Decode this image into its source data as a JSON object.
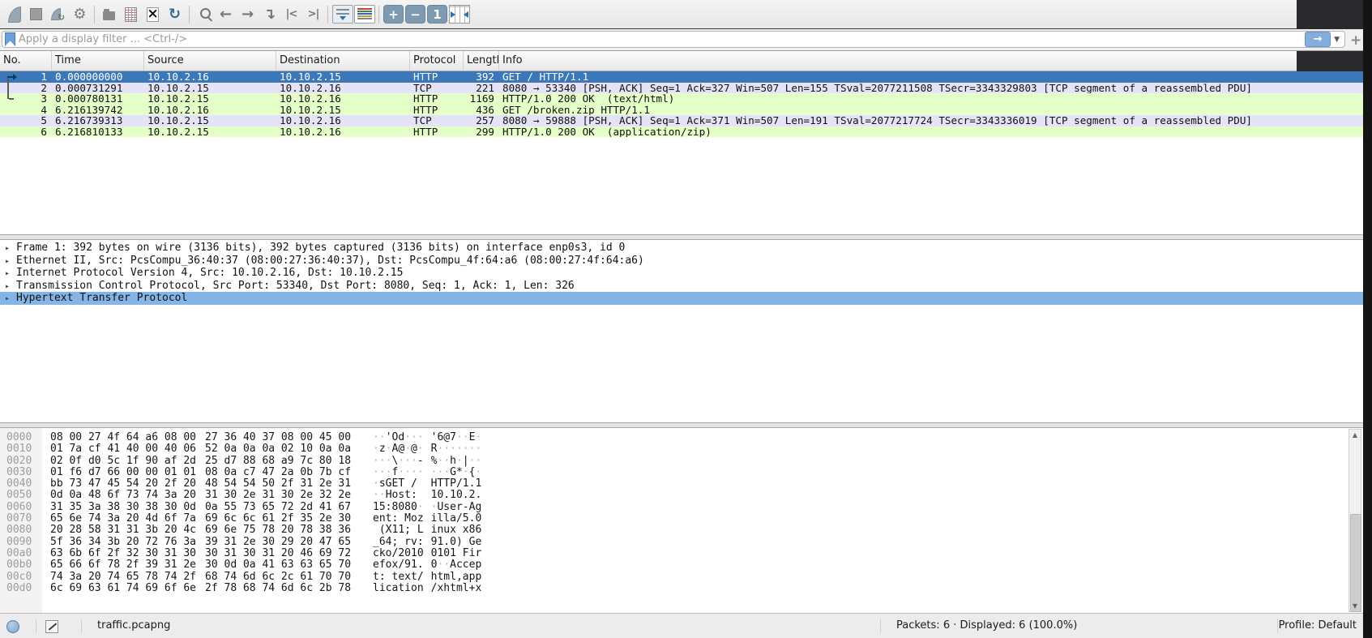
{
  "colors": {
    "selected_row": "#3c78b8",
    "tcp_row": "#e4e3f7",
    "http_row": "#e4ffc7",
    "details_selected": "#85b5e6",
    "apply_button": "#85acdd"
  },
  "toolbar": {
    "icons": [
      {
        "name": "start-capture-icon",
        "kind": "fin"
      },
      {
        "name": "stop-capture-icon",
        "kind": "stop"
      },
      {
        "name": "restart-capture-icon",
        "kind": "fin-restart",
        "glyph": "↻"
      },
      {
        "name": "capture-options-icon",
        "kind": "glyph",
        "glyph": "⚙"
      },
      {
        "kind": "separator"
      },
      {
        "name": "open-file-icon",
        "kind": "folder"
      },
      {
        "name": "save-file-icon",
        "kind": "savedoc"
      },
      {
        "name": "close-file-icon",
        "kind": "closedoc",
        "glyph": "×"
      },
      {
        "name": "reload-file-icon",
        "kind": "glyph-reload",
        "glyph": "↻"
      },
      {
        "kind": "separator"
      },
      {
        "name": "find-packet-icon",
        "kind": "magnifier"
      },
      {
        "name": "go-back-icon",
        "kind": "glyph",
        "glyph": "←"
      },
      {
        "name": "go-forward-icon",
        "kind": "glyph",
        "glyph": "→"
      },
      {
        "name": "go-to-packet-icon",
        "kind": "glyph",
        "glyph": "↴"
      },
      {
        "name": "go-first-packet-icon",
        "kind": "glyph-small",
        "glyph": "|<"
      },
      {
        "name": "go-last-packet-icon",
        "kind": "glyph-small",
        "glyph": ">|"
      },
      {
        "kind": "separator"
      },
      {
        "name": "auto-scroll-icon",
        "kind": "autoscroll"
      },
      {
        "name": "colorize-icon",
        "kind": "colorize"
      },
      {
        "kind": "separator"
      },
      {
        "name": "zoom-in-icon",
        "kind": "bluebtn",
        "glyph": "+"
      },
      {
        "name": "zoom-out-icon",
        "kind": "bluebtn",
        "glyph": "−"
      },
      {
        "name": "zoom-100-icon",
        "kind": "bluebtn",
        "glyph": "1"
      },
      {
        "name": "resize-columns-icon",
        "kind": "resizecols"
      }
    ]
  },
  "filter_bar": {
    "placeholder": "Apply a display filter ... <Ctrl-/>",
    "apply_arrow": "→",
    "dropdown_caret": "▼",
    "add_button": "+"
  },
  "packet_list": {
    "columns": [
      "No.",
      "Time",
      "Source",
      "Destination",
      "Protocol",
      "Length",
      "Info"
    ],
    "rows": [
      {
        "no": "1",
        "time": "0.000000000",
        "source": "10.10.2.16",
        "destination": "10.10.2.15",
        "protocol": "HTTP",
        "length": "392",
        "info": "GET / HTTP/1.1",
        "state": "selected"
      },
      {
        "no": "2",
        "time": "0.000731291",
        "source": "10.10.2.15",
        "destination": "10.10.2.16",
        "protocol": "TCP",
        "length": "221",
        "info": "8080 → 53340 [PSH, ACK] Seq=1 Ack=327 Win=507 Len=155 TSval=2077211508 TSecr=3343329803 [TCP segment of a reassembled PDU]",
        "state": "tcp"
      },
      {
        "no": "3",
        "time": "0.000780131",
        "source": "10.10.2.15",
        "destination": "10.10.2.16",
        "protocol": "HTTP",
        "length": "1169",
        "info": "HTTP/1.0 200 OK  (text/html)",
        "state": "http"
      },
      {
        "no": "4",
        "time": "6.216139742",
        "source": "10.10.2.16",
        "destination": "10.10.2.15",
        "protocol": "HTTP",
        "length": "436",
        "info": "GET /broken.zip HTTP/1.1",
        "state": "http"
      },
      {
        "no": "5",
        "time": "6.216739313",
        "source": "10.10.2.15",
        "destination": "10.10.2.16",
        "protocol": "TCP",
        "length": "257",
        "info": "8080 → 59888 [PSH, ACK] Seq=1 Ack=371 Win=507 Len=191 TSval=2077217724 TSecr=3343336019 [TCP segment of a reassembled PDU]",
        "state": "tcp"
      },
      {
        "no": "6",
        "time": "6.216810133",
        "source": "10.10.2.15",
        "destination": "10.10.2.16",
        "protocol": "HTTP",
        "length": "299",
        "info": "HTTP/1.0 200 OK  (application/zip)",
        "state": "http"
      }
    ]
  },
  "details": {
    "expander": "▸",
    "rows": [
      {
        "text": "Frame 1: 392 bytes on wire (3136 bits), 392 bytes captured (3136 bits) on interface enp0s3, id 0",
        "selected": false
      },
      {
        "text": "Ethernet II, Src: PcsCompu_36:40:37 (08:00:27:36:40:37), Dst: PcsCompu_4f:64:a6 (08:00:27:4f:64:a6)",
        "selected": false
      },
      {
        "text": "Internet Protocol Version 4, Src: 10.10.2.16, Dst: 10.10.2.15",
        "selected": false
      },
      {
        "text": "Transmission Control Protocol, Src Port: 53340, Dst Port: 8080, Seq: 1, Ack: 1, Len: 326",
        "selected": false
      },
      {
        "text": "Hypertext Transfer Protocol",
        "selected": true
      }
    ]
  },
  "hex_dump": {
    "rows": [
      {
        "offset": "0000",
        "hex1": "08 00 27 4f 64 a6 08 00",
        "hex2": "27 36 40 37 08 00 45 00",
        "ascii1": "··'Od···",
        "ascii2": "'6@7··E·"
      },
      {
        "offset": "0010",
        "hex1": "01 7a cf 41 40 00 40 06",
        "hex2": "52 0a 0a 0a 02 10 0a 0a",
        "ascii1": "·z·A@·@·",
        "ascii2": "R·······"
      },
      {
        "offset": "0020",
        "hex1": "02 0f d0 5c 1f 90 af 2d",
        "hex2": "25 d7 88 68 a9 7c 80 18",
        "ascii1": "···\\···-",
        "ascii2": "%··h·|··"
      },
      {
        "offset": "0030",
        "hex1": "01 f6 d7 66 00 00 01 01",
        "hex2": "08 0a c7 47 2a 0b 7b cf",
        "ascii1": "···f····",
        "ascii2": "···G*·{·"
      },
      {
        "offset": "0040",
        "hex1": "bb 73 47 45 54 20 2f 20",
        "hex2": "48 54 54 50 2f 31 2e 31",
        "ascii1": "·sGET / ",
        "ascii2": "HTTP/1.1"
      },
      {
        "offset": "0050",
        "hex1": "0d 0a 48 6f 73 74 3a 20",
        "hex2": "31 30 2e 31 30 2e 32 2e",
        "ascii1": "··Host: ",
        "ascii2": "10.10.2."
      },
      {
        "offset": "0060",
        "hex1": "31 35 3a 38 30 38 30 0d",
        "hex2": "0a 55 73 65 72 2d 41 67",
        "ascii1": "15:8080·",
        "ascii2": "·User-Ag"
      },
      {
        "offset": "0070",
        "hex1": "65 6e 74 3a 20 4d 6f 7a",
        "hex2": "69 6c 6c 61 2f 35 2e 30",
        "ascii1": "ent: Moz",
        "ascii2": "illa/5.0"
      },
      {
        "offset": "0080",
        "hex1": "20 28 58 31 31 3b 20 4c",
        "hex2": "69 6e 75 78 20 78 38 36",
        "ascii1": " (X11; L",
        "ascii2": "inux x86"
      },
      {
        "offset": "0090",
        "hex1": "5f 36 34 3b 20 72 76 3a",
        "hex2": "39 31 2e 30 29 20 47 65",
        "ascii1": "_64; rv:",
        "ascii2": "91.0) Ge"
      },
      {
        "offset": "00a0",
        "hex1": "63 6b 6f 2f 32 30 31 30",
        "hex2": "30 31 30 31 20 46 69 72",
        "ascii1": "cko/2010",
        "ascii2": "0101 Fir"
      },
      {
        "offset": "00b0",
        "hex1": "65 66 6f 78 2f 39 31 2e",
        "hex2": "30 0d 0a 41 63 63 65 70",
        "ascii1": "efox/91.",
        "ascii2": "0··Accep"
      },
      {
        "offset": "00c0",
        "hex1": "74 3a 20 74 65 78 74 2f",
        "hex2": "68 74 6d 6c 2c 61 70 70",
        "ascii1": "t: text/",
        "ascii2": "html,app"
      },
      {
        "offset": "00d0",
        "hex1": "6c 69 63 61 74 69 6f 6e",
        "hex2": "2f 78 68 74 6d 6c 2b 78",
        "ascii1": "lication",
        "ascii2": "/xhtml+x"
      }
    ]
  },
  "status_bar": {
    "filename": "traffic.pcapng",
    "packets_summary": "Packets: 6 · Displayed: 6 (100.0%)",
    "profile": "Profile: Default"
  }
}
